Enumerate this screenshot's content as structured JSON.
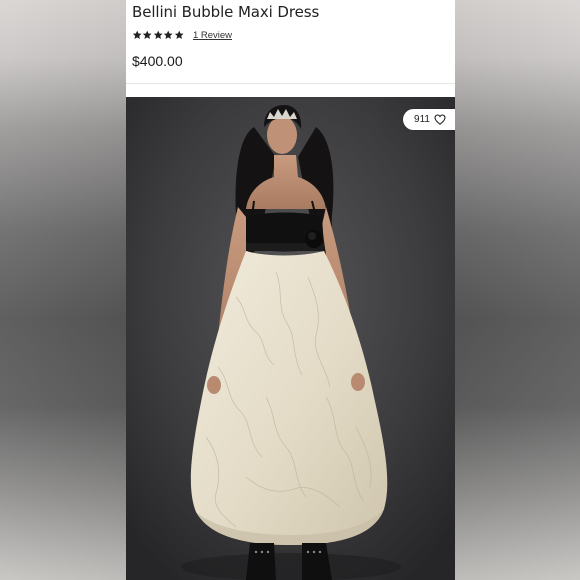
{
  "product": {
    "title": "Bellini Bubble Maxi Dress",
    "rating": 5,
    "rating_max": 5,
    "review_link": "1 Review",
    "price": "$400.00"
  },
  "image": {
    "like_count": "911",
    "heart_icon": "heart-outline-icon",
    "description_icon": "model-wearing-dress-photo"
  },
  "colors": {
    "star": "#222222",
    "photo_background": "#3f3f41",
    "dress_skirt": "#e8e1cf",
    "dress_bodice": "#121212"
  }
}
